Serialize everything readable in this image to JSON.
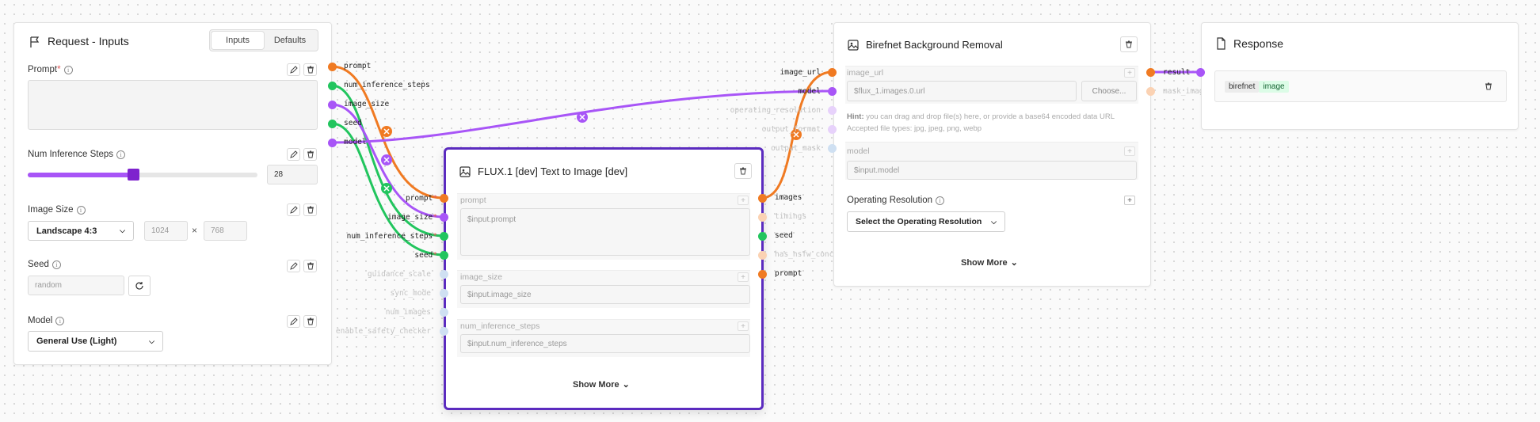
{
  "inputs_card": {
    "title": "Request - Inputs",
    "tabs": [
      "Inputs",
      "Defaults"
    ],
    "prompt": {
      "label": "Prompt",
      "required": "*",
      "value": ""
    },
    "steps": {
      "label": "Num Inference Steps",
      "value": "28",
      "fraction": 0.46
    },
    "image_size": {
      "label": "Image Size",
      "select": "Landscape 4:3",
      "width": "1024",
      "times": "×",
      "height": "768"
    },
    "seed": {
      "label": "Seed",
      "placeholder": "random"
    },
    "model": {
      "label": "Model",
      "select": "General Use (Light)"
    }
  },
  "inputs_pins": [
    "prompt",
    "num_inference_steps",
    "image_size",
    "seed",
    "model"
  ],
  "flux_card": {
    "title": "FLUX.1 [dev] Text to Image [dev]",
    "in_pins_active": [
      "prompt",
      "image_size",
      "num_inference_steps",
      "seed"
    ],
    "in_pins_faint": [
      "guidance_scale",
      "sync_mode",
      "num_images",
      "enable_safety_checker"
    ],
    "out_pins": [
      "images",
      "timings",
      "seed",
      "has_nsfw_concepts",
      "prompt"
    ],
    "fields": [
      {
        "label": "prompt",
        "value": "$input.prompt"
      },
      {
        "label": "image_size",
        "value": "$input.image_size"
      },
      {
        "label": "num_inference_steps",
        "value": "$input.num_inference_steps"
      }
    ],
    "show_more": "Show More"
  },
  "birefnet_card": {
    "title": "Birefnet Background Removal",
    "in_pins": [
      "image_url",
      "model",
      "operating_resolution",
      "output_format",
      "output_mask"
    ],
    "out_pins": [
      "result",
      "mask_image"
    ],
    "image_url": {
      "label": "image_url",
      "value": "$flux_1.images.0.url",
      "choose": "Choose...",
      "hint_bold": "Hint:",
      "hint": "you can drag and drop file(s) here, or provide a base64 encoded data URL Accepted file types: jpg, jpeg, png, webp"
    },
    "model_field": {
      "label": "model",
      "value": "$input.model"
    },
    "op_res": {
      "label": "Operating Resolution",
      "select": "Select the Operating Resolution"
    },
    "show_more": "Show More"
  },
  "response_card": {
    "title": "Response",
    "tags": [
      "birefnet",
      "image"
    ]
  },
  "colors": {
    "orange": "#f07a22",
    "purple": "#a855f7",
    "green": "#22c55e",
    "flux_border": "#5b2bbf"
  }
}
